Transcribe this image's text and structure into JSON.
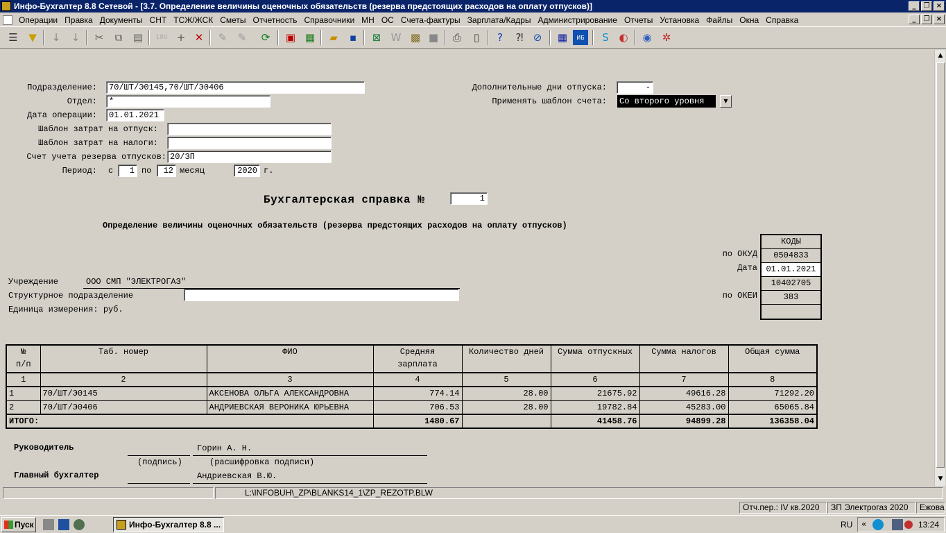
{
  "window": {
    "title": "Инфо-Бухгалтер 8.8 Сетевой - [3.7. Определение величины оценочных обязательств (резерва предстоящих расходов на оплату отпусков)]"
  },
  "menu": [
    "Операции",
    "Правка",
    "Документы",
    "СНТ",
    "ТСЖ/ЖСК",
    "Сметы",
    "Отчетность",
    "Справочники",
    "МН",
    "ОС",
    "Счета-фактуры",
    "Зарплата/Кадры",
    "Администрирование",
    "Отчеты",
    "Установка",
    "Файлы",
    "Окна",
    "Справка"
  ],
  "form": {
    "podrazdelenie_label": "Подразделение:",
    "podrazdelenie_value": "70/ШТ/Э0145,70/ШТ/Э0406",
    "otdel_label": "Отдел:",
    "otdel_value": "*",
    "date_label": "Дата операции:",
    "date_value": "01.01.2021",
    "shablon_otpusk_label": "Шаблон затрат на отпуск:",
    "shablon_otpusk_value": "",
    "shablon_nalogi_label": "Шаблон затрат на налоги:",
    "shablon_nalogi_value": "",
    "schet_label": "Счет учета резерва отпусков:",
    "schet_value": "20/ЗП",
    "period_label": "Период:",
    "period_from_label": "с",
    "period_from": "1",
    "period_to_label": "по",
    "period_to": "12",
    "period_month_label": "месяц",
    "period_year": "2020",
    "period_year_suffix": "г.",
    "dop_dni_label": "Дополнительные дни отпуска:",
    "dop_dni_value": "-",
    "shablon_scheta_label": "Применять шаблон счета:",
    "shablon_scheta_value": "Со второго уровня"
  },
  "report": {
    "title": "Бухгалтерская справка №",
    "number": "1",
    "subtitle": "Определение величины оценочных обязательств (резерва предстоящих расходов на оплату отпусков)",
    "uchrezhdenie_label": "Учреждение",
    "uchrezhdenie_value": "ООО СМП \"ЭЛЕКТРОГАЗ\"",
    "struct_label": "Структурное подразделение",
    "struct_value": "",
    "unit_label": "Единица измерения: руб.",
    "codes_header": "КОДЫ",
    "okud_label": "по ОКУД",
    "okud_value": "0504833",
    "date_label": "Дата",
    "date_value": "01.01.2021",
    "code3_value": "10402705",
    "okei_label": "по ОКЕИ",
    "okei_value": "383",
    "code5_value": ""
  },
  "table": {
    "headers": [
      "№\nп/п",
      "Таб. номер",
      "ФИО",
      "Средняя\nзарплата",
      "Количество дней",
      "Сумма отпускных",
      "Сумма налогов",
      "Общая сумма"
    ],
    "col_numbers": [
      "1",
      "2",
      "3",
      "4",
      "5",
      "6",
      "7",
      "8"
    ],
    "rows": [
      [
        "1",
        "70/ШТ/Э0145",
        "АКСЕНОВА ОЛЬГА АЛЕКСАНДРОВНА",
        "774.14",
        "28.00",
        "21675.92",
        "49616.28",
        "71292.20"
      ],
      [
        "2",
        "70/ШТ/Э0406",
        "АНДРИЕВСКАЯ ВЕРОНИКА ЮРЬЕВНА",
        "706.53",
        "28.00",
        "19782.84",
        "45283.00",
        "65065.84"
      ]
    ],
    "total": [
      "ИТОГО:",
      "1480.67",
      "",
      "41458.76",
      "94899.28",
      "136358.04"
    ]
  },
  "signatures": {
    "head_label": "Руководитель",
    "head_name": "Горин А. Н.",
    "sign_caption": "(подпись)",
    "decode_caption": "(расшифровка подписи)",
    "chief_label": "Главный бухгалтер",
    "chief_name": "Андриевская В.Ю."
  },
  "status": {
    "path": "L:\\INFOBUH\\_ZP\\BLANKS14_1\\ZP_REZOTP.BLW",
    "period": "Отч.пер.: IV кв.2020",
    "company": "ЗП Электрогаз 2020",
    "user": "Ежова"
  },
  "taskbar": {
    "start": "Пуск",
    "task": "Инфо-Бухгалтер 8.8 ...",
    "lang": "RU",
    "clock": "13:24"
  }
}
